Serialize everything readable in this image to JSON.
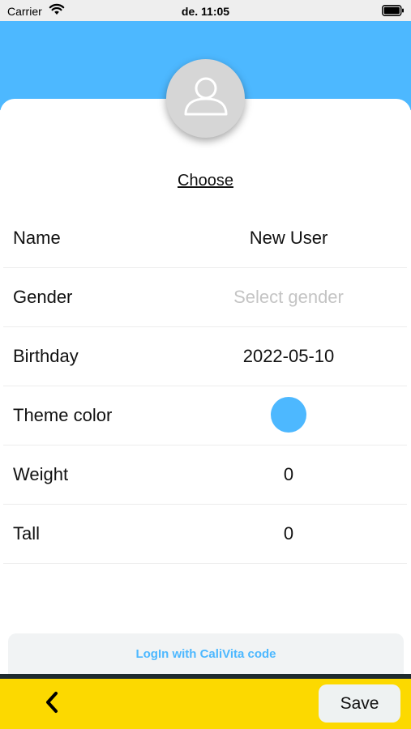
{
  "status_bar": {
    "carrier": "Carrier",
    "time": "de. 11:05",
    "icons": [
      "wifi-icon",
      "battery-icon"
    ]
  },
  "colors": {
    "header": "#4db8ff",
    "theme_color": "#4db8ff",
    "bottom_bar": "#fcd900",
    "login_text": "#4db8ff"
  },
  "profile": {
    "avatar_icon": "user-icon",
    "choose_label": "Choose"
  },
  "fields": [
    {
      "label": "Name",
      "value": "New User"
    },
    {
      "label": "Gender",
      "value": "",
      "placeholder": "Select gender"
    },
    {
      "label": "Birthday",
      "value": "2022-05-10"
    },
    {
      "label": "Theme color",
      "color": "#4db8ff"
    },
    {
      "label": "Weight",
      "value": "0"
    },
    {
      "label": "Tall",
      "value": "0"
    }
  ],
  "login": {
    "label": "LogIn with CaliVita code"
  },
  "bottom_bar": {
    "back_icon": "chevron-left-icon",
    "save_label": "Save"
  }
}
